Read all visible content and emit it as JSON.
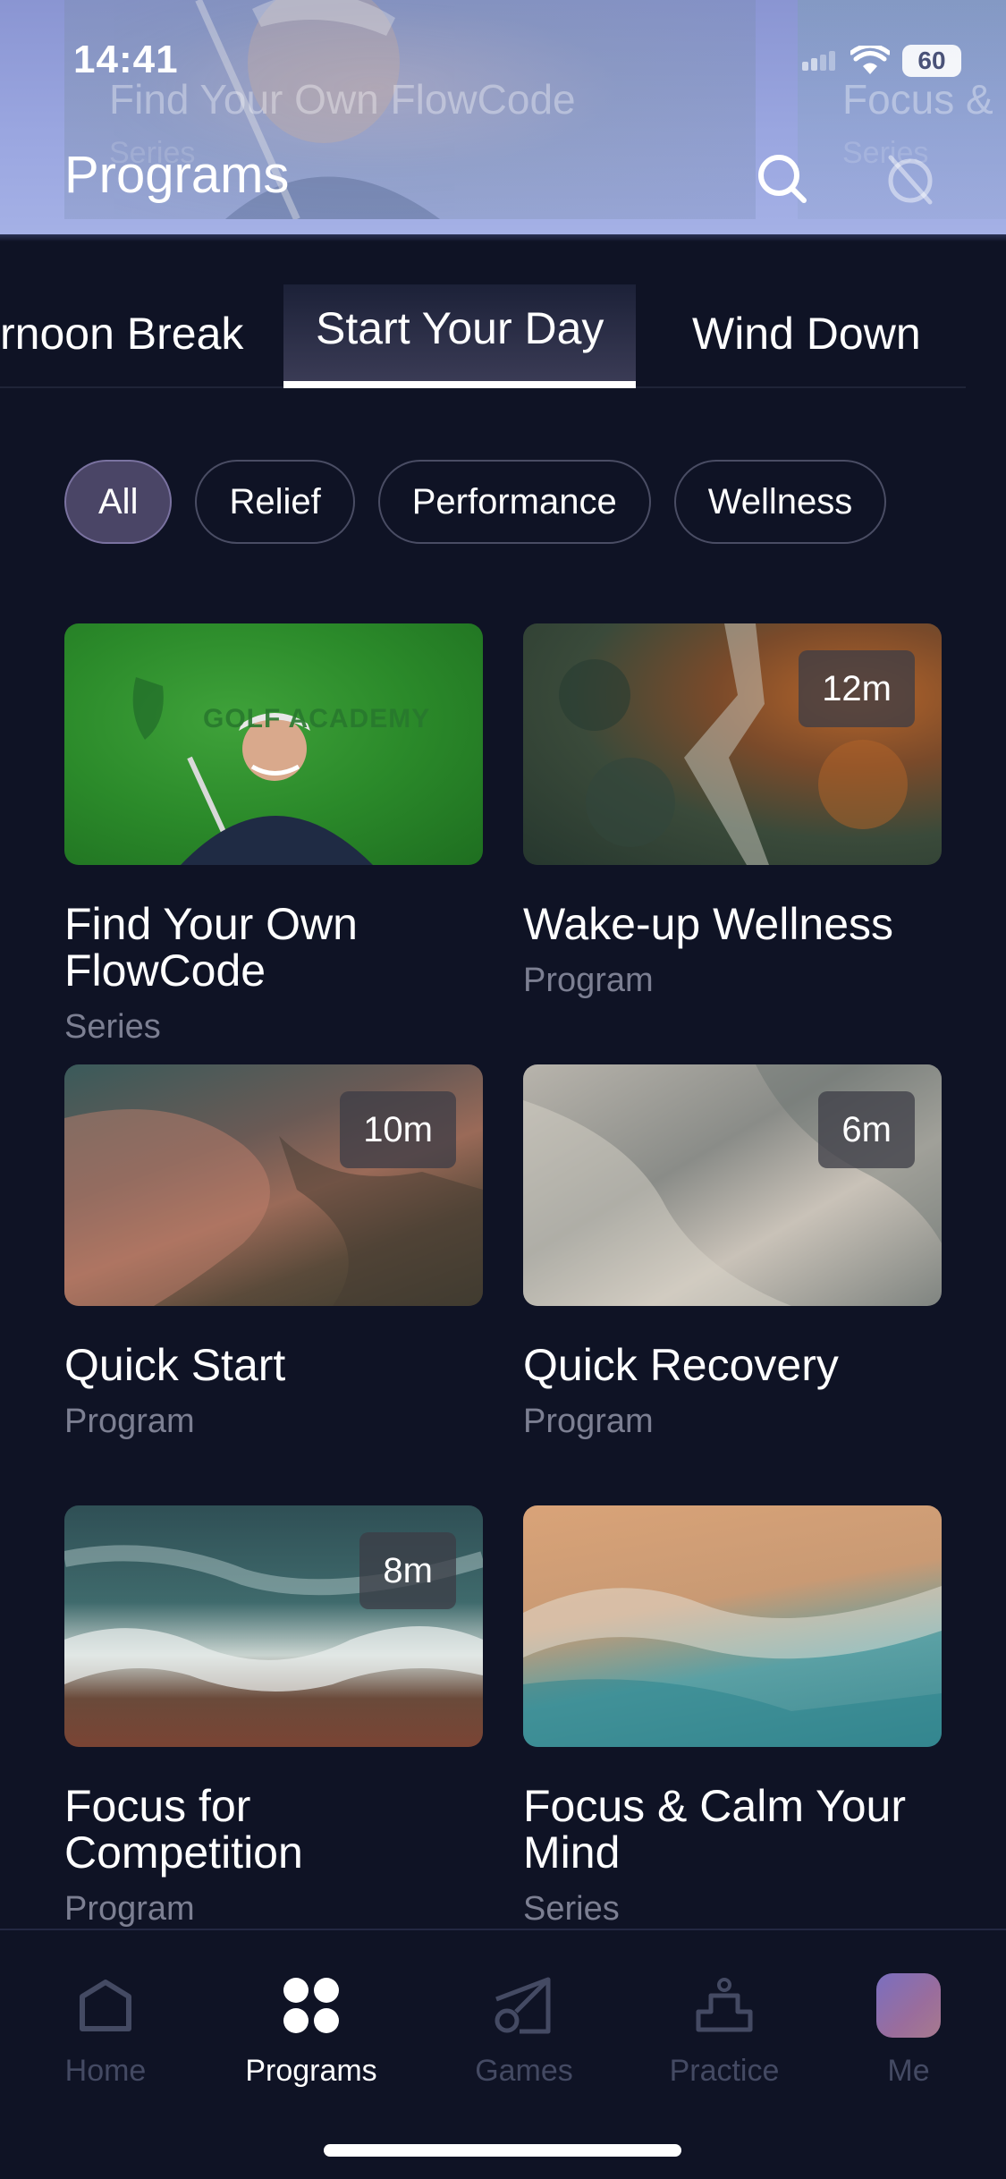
{
  "status_bar": {
    "time": "14:41",
    "battery": "60"
  },
  "header": {
    "title": "Programs",
    "background_titles": [
      "Find Your Own FlowCode",
      "Focus &"
    ],
    "background_subtitles": [
      "Series",
      "Series"
    ],
    "search_icon": "search-icon",
    "cast_icon": "cast-off-icon"
  },
  "category_tabs": [
    {
      "label": "rnoon Break"
    },
    {
      "label": "Start Your Day",
      "active": true
    },
    {
      "label": "Wind Down"
    }
  ],
  "filters": [
    {
      "label": "All",
      "active": true
    },
    {
      "label": "Relief"
    },
    {
      "label": "Performance"
    },
    {
      "label": "Wellness"
    }
  ],
  "cards": [
    {
      "title": "Find Your Own FlowCode",
      "type": "Series",
      "duration": "",
      "logo_text": "GOLF ACADEMY"
    },
    {
      "title": "Wake-up Wellness",
      "type": "Program",
      "duration": "12m"
    },
    {
      "title": "Quick Start",
      "type": "Program",
      "duration": "10m"
    },
    {
      "title": "Quick Recovery",
      "type": "Program",
      "duration": "6m"
    },
    {
      "title": "Focus for Competition",
      "type": "Program",
      "duration": "8m"
    },
    {
      "title": "Focus & Calm Your Mind",
      "type": "Series",
      "duration": ""
    }
  ],
  "tabbar": [
    {
      "label": "Home",
      "icon": "home-icon"
    },
    {
      "label": "Programs",
      "icon": "programs-grid-icon",
      "active": true
    },
    {
      "label": "Games",
      "icon": "games-icon"
    },
    {
      "label": "Practice",
      "icon": "practice-icon"
    },
    {
      "label": "Me",
      "icon": "avatar"
    }
  ],
  "colors": {
    "background": "#0f1325",
    "header": "#9aa6e0",
    "accent_chip": "#4a4566",
    "muted_text": "#7c7f92"
  }
}
